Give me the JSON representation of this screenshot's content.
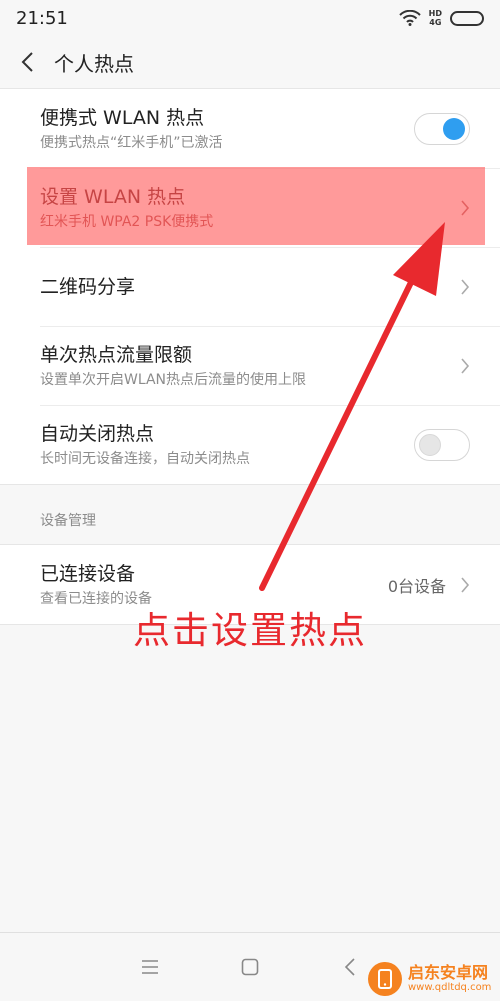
{
  "status_bar": {
    "time": "21:51",
    "hd": "HD",
    "network": "4G",
    "wifi_icon": "wifi-icon",
    "battery_icon": "battery-icon"
  },
  "header": {
    "back_icon": "back-chevron-icon",
    "title": "个人热点"
  },
  "settings": [
    {
      "title": "便携式 WLAN 热点",
      "subtitle": "便携式热点“红米手机”已激活",
      "control": "toggle",
      "on": true
    },
    {
      "title": "设置 WLAN 热点",
      "subtitle": "红米手机 WPA2 PSK便携式",
      "control": "chevron",
      "highlighted": true
    },
    {
      "title": "二维码分享",
      "control": "chevron"
    },
    {
      "title": "单次热点流量限额",
      "subtitle": "设置单次开启WLAN热点后流量的使用上限",
      "control": "chevron"
    },
    {
      "title": "自动关闭热点",
      "subtitle": "长时间无设备连接，自动关闭热点",
      "control": "toggle",
      "on": false
    }
  ],
  "device_section": {
    "header": "设备管理",
    "items": [
      {
        "title": "已连接设备",
        "subtitle": "查看已连接的设备",
        "value": "0台设备",
        "control": "chevron"
      }
    ]
  },
  "annotation": {
    "text": "点击设置热点",
    "color": "#e8292e"
  },
  "nav_bar": {
    "menu_icon": "menu-icon",
    "home_icon": "home-icon",
    "back_icon": "back-icon"
  },
  "watermark": {
    "title": "启东安卓网",
    "url": "www.qdltdq.com"
  },
  "colors": {
    "accent": "#2f9ef0",
    "highlight": "#ff5c5c",
    "annotation": "#e8292e"
  }
}
